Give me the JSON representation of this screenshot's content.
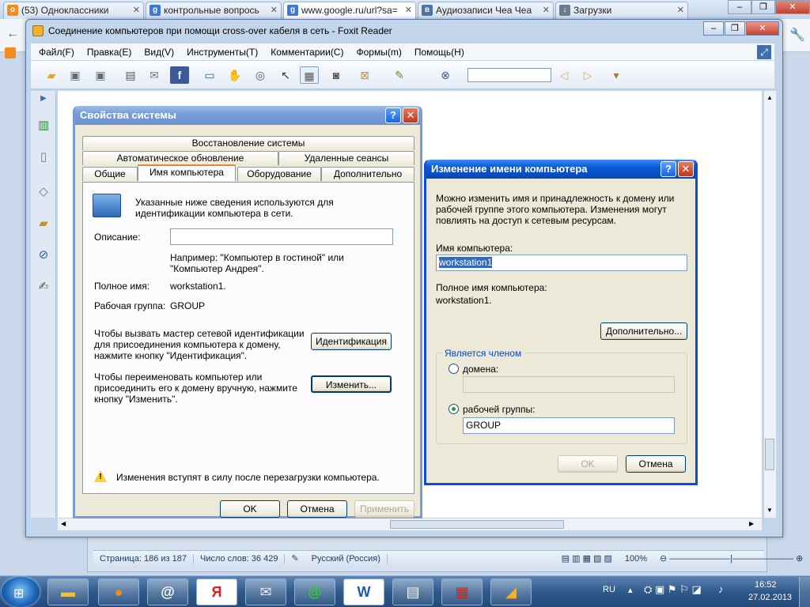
{
  "browser": {
    "tabs": [
      {
        "label": "(53) Одноклассники",
        "fav": "ok",
        "color": "#f28c1a"
      },
      {
        "label": "контрольные вопрось",
        "fav": "g",
        "color": "#3c78d8"
      },
      {
        "label": "www.google.ru/url?sa=",
        "fav": "g",
        "color": "#3c78d8"
      },
      {
        "label": "Аудиозаписи Чеа Чеа",
        "fav": "vk",
        "color": "#4c75a3"
      },
      {
        "label": "Загрузки",
        "fav": "dl",
        "color": "#6a7c92"
      }
    ]
  },
  "foxit": {
    "title": "Соединение компьютеров при помощи cross-over кабеля в сеть - Foxit Reader",
    "menu": [
      "Файл(F)",
      "Правка(E)",
      "Вид(V)",
      "Инструменты(T)",
      "Комментарии(C)",
      "Формы(m)",
      "Помощь(H)"
    ]
  },
  "sysprops": {
    "title": "Свойства системы",
    "tabs_row1": [
      "Восстановление системы"
    ],
    "tabs_row2": [
      "Автоматическое обновление",
      "Удаленные сеансы"
    ],
    "tabs_row3": [
      "Общие",
      "Имя компьютера",
      "Оборудование",
      "Дополнительно"
    ],
    "info_line1": "Указанные ниже сведения используются для",
    "info_line2": "идентификации компьютера в сети.",
    "desc_label": "Описание:",
    "desc_value": "",
    "example_line1": "Например: \"Компьютер в гостиной\" или",
    "example_line2": "\"Компьютер Андрея\".",
    "fullname_label": "Полное имя:",
    "fullname_value": "workstation1.",
    "workgroup_label": "Рабочая группа:",
    "workgroup_value": "GROUP",
    "wizard_line1": "Чтобы вызвать мастер сетевой идентификации",
    "wizard_line2": "для присоединения компьютера к домену,",
    "wizard_line3": "нажмите кнопку \"Идентификация\".",
    "ident_button": "Идентификация",
    "rename_line1": "Чтобы переименовать компьютер или",
    "rename_line2": "присоединить его к домену вручную, нажмите",
    "rename_line3": "кнопку \"Изменить\".",
    "change_button": "Изменить...",
    "warning": "Изменения вступят в силу после перезагрузки компьютера.",
    "ok": "OK",
    "cancel": "Отмена",
    "apply": "Применить"
  },
  "rename": {
    "title": "Изменение имени компьютера",
    "info_line1": "Можно изменить имя и принадлежность к домену или",
    "info_line2": "рабочей группе этого компьютера. Изменения могут",
    "info_line3": "повлиять на доступ к сетевым ресурсам.",
    "name_label": "Имя компьютера:",
    "name_value": "workstation1",
    "fullname_label": "Полное имя компьютера:",
    "fullname_value": "workstation1.",
    "more_button": "Дополнительно...",
    "member_group": "Является членом",
    "domain_label": "домена:",
    "domain_value": "",
    "workgroup_label": "рабочей группы:",
    "workgroup_value": "GROUP",
    "ok": "OK",
    "cancel": "Отмена"
  },
  "word_status": {
    "page": "Страница: 186 из 187",
    "words": "Число слов: 36 429",
    "language": "Русский (Россия)",
    "zoom": "100%"
  },
  "taskbar": {
    "lang": "RU",
    "time": "16:52",
    "date": "27.02.2013"
  }
}
